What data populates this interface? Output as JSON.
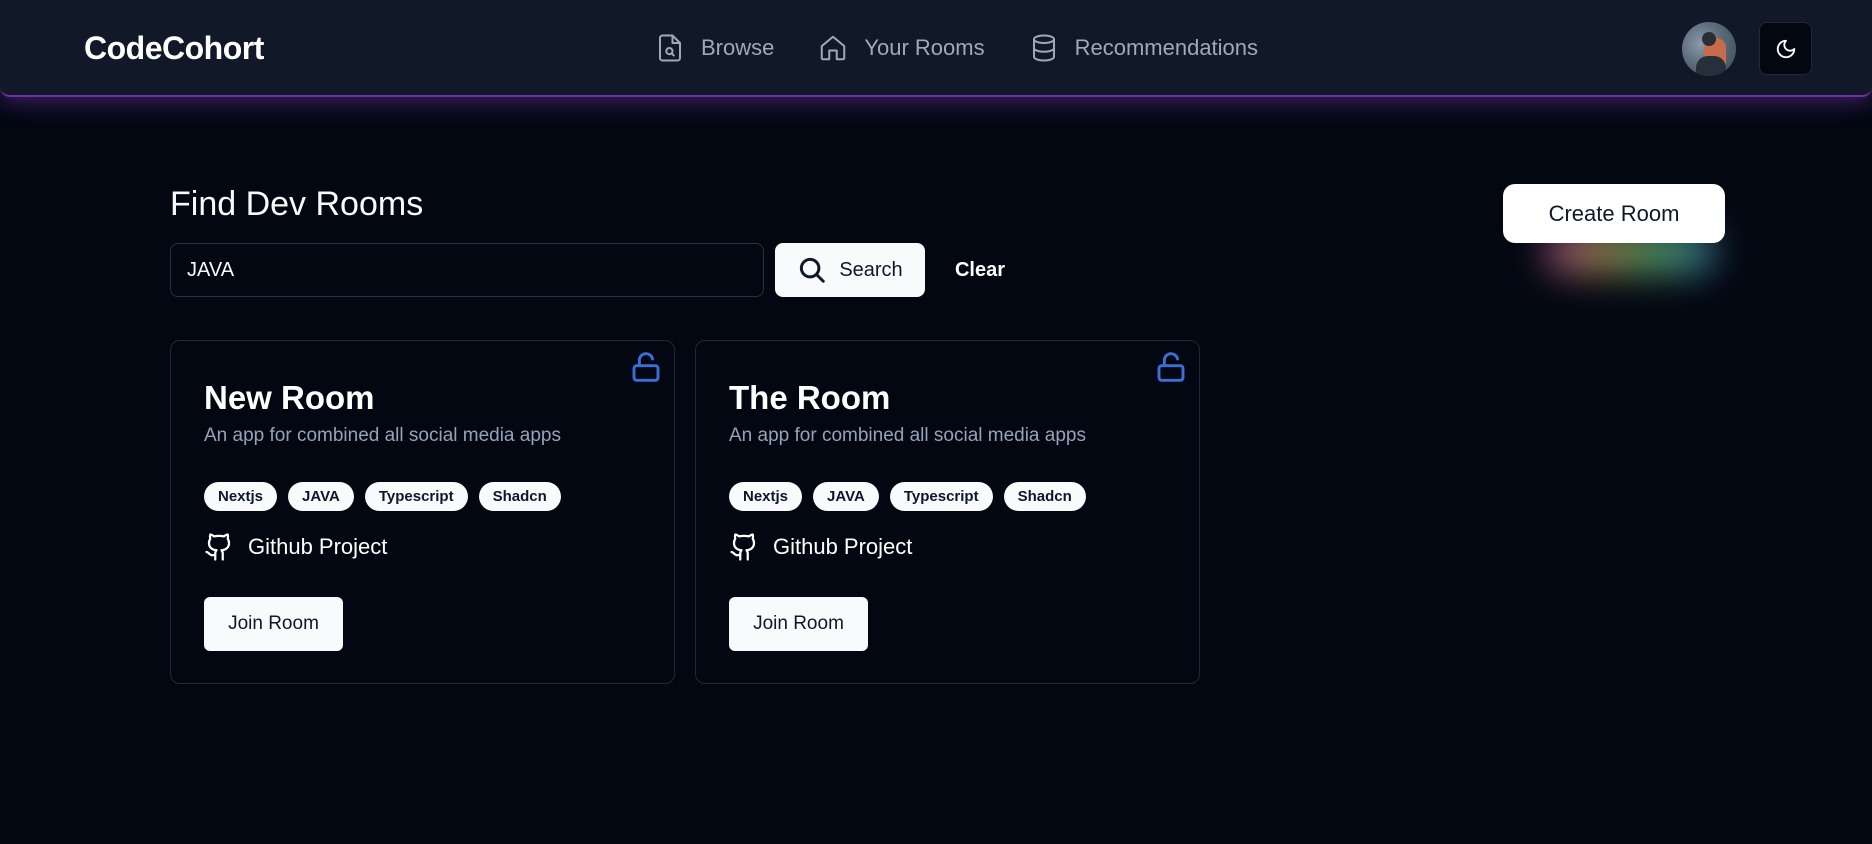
{
  "navbar": {
    "brand": "CodeCohort",
    "links": [
      {
        "label": "Browse",
        "icon": "file-search-icon"
      },
      {
        "label": "Your Rooms",
        "icon": "home-icon"
      },
      {
        "label": "Recommendations",
        "icon": "database-icon"
      }
    ],
    "theme_icon": "moon-icon"
  },
  "page": {
    "title": "Find Dev Rooms",
    "create_label": "Create Room"
  },
  "search": {
    "value": "JAVA",
    "button_label": "Search",
    "clear_label": "Clear"
  },
  "rooms": [
    {
      "title": "New Room",
      "description": "An app for combined all social media apps",
      "tags": [
        "Nextjs",
        "JAVA",
        "Typescript",
        "Shadcn"
      ],
      "github_label": "Github Project",
      "join_label": "Join Room",
      "lock_icon": "unlock-icon"
    },
    {
      "title": "The Room",
      "description": "An app for combined all social media apps",
      "tags": [
        "Nextjs",
        "JAVA",
        "Typescript",
        "Shadcn"
      ],
      "github_label": "Github Project",
      "join_label": "Join Room",
      "lock_icon": "unlock-icon"
    }
  ],
  "colors": {
    "background": "#030712",
    "navbar": "#111827",
    "accent_glow": "#6b2fa8",
    "lock_icon": "#3b6fd8"
  }
}
